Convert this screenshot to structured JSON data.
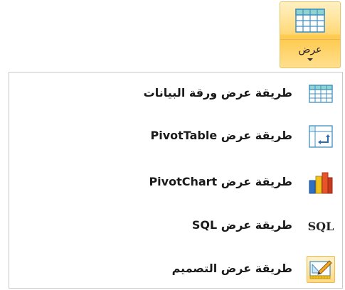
{
  "ribbon": {
    "view_button": {
      "label": "عرض",
      "icon": "datasheet-grid-icon"
    }
  },
  "menu": {
    "items": [
      {
        "label": "طريقة عرض ورقة البيانات",
        "icon": "datasheet-grid-icon"
      },
      {
        "label": "طريقة عرض PivotTable",
        "icon": "pivot-table-icon"
      },
      {
        "label": "طريقة عرض PivotChart",
        "icon": "pivot-chart-icon"
      },
      {
        "label": "طريقة عرض SQL",
        "icon": "sql-icon",
        "icon_text": "SQL"
      },
      {
        "label": "طريقة عرض التصميم",
        "icon": "design-view-icon",
        "selected": true
      }
    ]
  },
  "colors": {
    "accent_border": "#f2b84a",
    "highlight_fill": "#ffd985",
    "grid_blue": "#3f8fbf",
    "grid_teal": "#8fd3cf"
  }
}
